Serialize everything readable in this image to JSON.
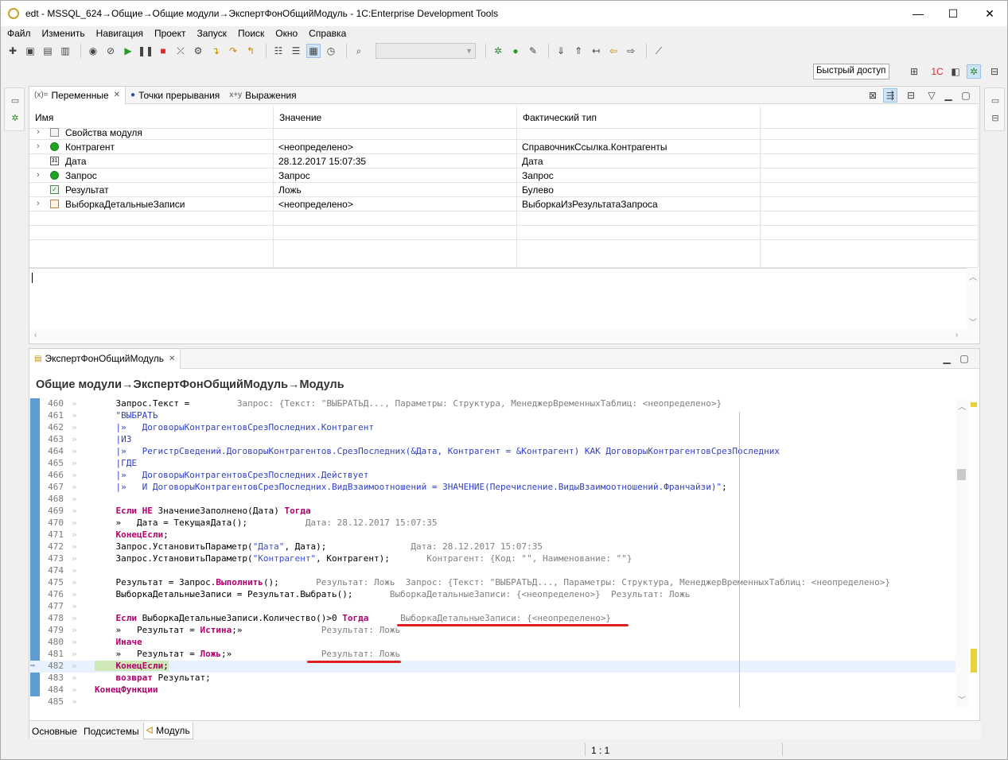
{
  "window": {
    "title": "edt - MSSQL_624→Общие→Общие модули→ЭкспертФонОбщийМодуль - 1C:Enterprise Development Tools",
    "min": "—",
    "max": "☐",
    "close": "✕"
  },
  "menu": [
    "Файл",
    "Изменить",
    "Навигация",
    "Проект",
    "Запуск",
    "Поиск",
    "Окно",
    "Справка"
  ],
  "quick_access": "Быстрый доступ",
  "variables_panel": {
    "tabs": [
      {
        "label": "Переменные",
        "icon": "(x)="
      },
      {
        "label": "Точки прерывания",
        "icon": "●"
      },
      {
        "label": "Выражения",
        "icon": "x+y"
      }
    ],
    "columns": [
      "Имя",
      "Значение",
      "Фактический тип"
    ],
    "rows": [
      {
        "name": "Свойства модуля",
        "value": "",
        "type": "",
        "expandable": true,
        "icon": "module-props-icon"
      },
      {
        "name": "Контрагент",
        "value": "<неопределено>",
        "type": "СправочникСсылка.Контрагенты",
        "expandable": true,
        "icon": "green-dot-icon"
      },
      {
        "name": "Дата",
        "value": "28.12.2017 15:07:35",
        "type": "Дата",
        "expandable": false,
        "icon": "calendar-icon"
      },
      {
        "name": "Запрос",
        "value": "Запрос",
        "type": "Запрос",
        "expandable": true,
        "icon": "green-dot-icon"
      },
      {
        "name": "Результат",
        "value": "Ложь",
        "type": "Булево",
        "expandable": false,
        "icon": "checkbox-icon"
      },
      {
        "name": "ВыборкаДетальныеЗаписи",
        "value": "<неопределено>",
        "type": "ВыборкаИзРезультатаЗапроса",
        "expandable": true,
        "icon": "table-icon"
      }
    ]
  },
  "editor": {
    "tab_label": "ЭкспертФонОбщийМодуль",
    "title": "Общие модули→ЭкспертФонОбщийМодуль→Модуль",
    "lines": [
      {
        "n": "460",
        "html": "    Запрос.Текст = <span class='ann'>        Запрос: {Текст: \"ВЫБРАТЬД..., Параметры: Структура, МенеджерВременныхТаблиц: &lt;неопределено&gt;}</span>"
      },
      {
        "n": "461",
        "html": "    <span class='q'>\"ВЫБРАТЬ</span>"
      },
      {
        "n": "462",
        "html": "    <span class='q'>|»   ДоговорыКонтрагентовСрезПоследних.Контрагент</span>"
      },
      {
        "n": "463",
        "html": "    <span class='q'>|ИЗ</span>"
      },
      {
        "n": "464",
        "html": "    <span class='q'>|»   РегистрСведений.ДоговорыКонтрагентов.СрезПоследних(&amp;Дата, Контрагент = &amp;Контрагент) КАК ДоговорыКонтрагентовСрезПоследних</span>"
      },
      {
        "n": "465",
        "html": "    <span class='q'>|ГДЕ</span>"
      },
      {
        "n": "466",
        "html": "    <span class='q'>|»   ДоговорыКонтрагентовСрезПоследних.Действует</span>"
      },
      {
        "n": "467",
        "html": "    <span class='q'>|»   И ДоговорыКонтрагентовСрезПоследних.ВидВзаимоотношений = ЗНАЧЕНИЕ(Перечисление.ВидыВзаимоотношений.Франчайзи)\"</span>;"
      },
      {
        "n": "468",
        "html": ""
      },
      {
        "n": "469",
        "html": "    <span class='kw'>Если</span> <span class='kw'>НЕ</span> ЗначениеЗаполнено(Дата) <span class='kw'>Тогда</span>"
      },
      {
        "n": "470",
        "html": "    »   Дата = ТекущаяДата();           <span class='ann'>Дата: 28.12.2017 15:07:35</span>"
      },
      {
        "n": "471",
        "html": "    <span class='kw'>КонецЕсли</span>;"
      },
      {
        "n": "472",
        "html": "    Запрос.УстановитьПараметр(<span class='str'>\"Дата\"</span>, Дата);                <span class='ann'>Дата: 28.12.2017 15:07:35</span>"
      },
      {
        "n": "473",
        "html": "    Запрос.УстановитьПараметр(<span class='str'>\"Контрагент\"</span>, Контрагент);       <span class='ann'>Контрагент: {Код: \"\", Наименование: \"\"}</span>"
      },
      {
        "n": "474",
        "html": ""
      },
      {
        "n": "475",
        "html": "    Результат = Запрос.<span class='kw'>Выполнить</span>();       <span class='ann'>Результат: Ложь  Запрос: {Текст: \"ВЫБРАТЬД..., Параметры: Структура, МенеджерВременныхТаблиц: &lt;неопределено&gt;}</span>"
      },
      {
        "n": "476",
        "html": "    ВыборкаДетальныеЗаписи = Результат.Выбрать();       <span class='ann'>ВыборкаДетальныеЗаписи: {&lt;неопределено&gt;}  Результат: Ложь</span>"
      },
      {
        "n": "477",
        "html": ""
      },
      {
        "n": "478",
        "html": "    <span class='kw'>Если</span> ВыборкаДетальныеЗаписи.Количество()&gt;0 <span class='kw'>Тогда</span>      <span class='ann'>ВыборкаДетальныеЗаписи: {&lt;неопределено&gt;}</span>"
      },
      {
        "n": "479",
        "html": "    »   Результат = <span class='kw'>Истина</span>;»               <span class='ann'>Результат: Ложь</span>"
      },
      {
        "n": "480",
        "html": "    <span class='kw'>Иначе</span>"
      },
      {
        "n": "481",
        "html": "    »   Результат = <span class='kw'>Ложь</span>;»                 <span class='ann'>Результат: Ложь</span>"
      },
      {
        "n": "482",
        "html": "<span class='hl'>    <span class='kw'>КонецЕсли</span>;</span>"
      },
      {
        "n": "483",
        "html": "    <span class='kw'>возврат</span> Результат;"
      },
      {
        "n": "484",
        "html": "<span class='kw'>КонецФункции</span>"
      },
      {
        "n": "485",
        "html": ""
      }
    ],
    "bottom_tabs": [
      "Основные",
      "Подсистемы",
      "Модуль"
    ]
  },
  "status": {
    "position": "1 : 1"
  }
}
